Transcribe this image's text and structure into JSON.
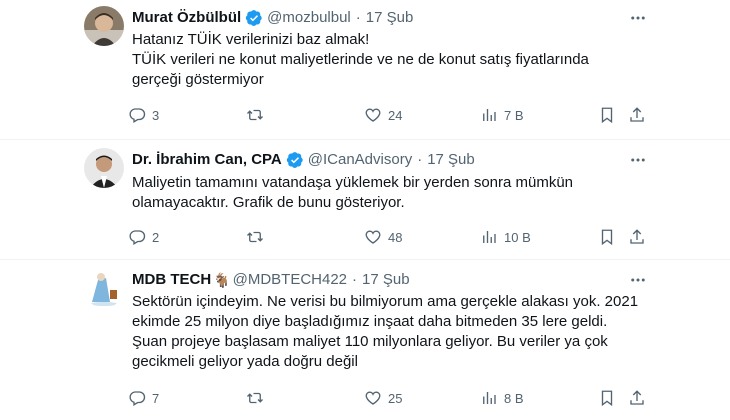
{
  "tweets": [
    {
      "name": "Murat Özbülbül",
      "handle": "@mozbulbul",
      "date": "17 Şub",
      "dot": "·",
      "lines": [
        "Hatanız TÜİK verilerinizi baz almak!",
        "TÜİK verileri ne konut maliyetlerinde ve ne de konut satış fiyatlarında",
        "gerçeği göstermiyor"
      ],
      "replies": "3",
      "retweets": "",
      "likes": "24",
      "views": "7 B"
    },
    {
      "name": "Dr. İbrahim Can, CPA",
      "handle": "@ICanAdvisory",
      "date": "17 Şub",
      "dot": "·",
      "lines": [
        "Maliyetin tamamını vatandaşa yüklemek bir yerden sonra mümkün",
        "olamayacaktır. Grafik de bunu gösteriyor."
      ],
      "replies": "2",
      "retweets": "",
      "likes": "48",
      "views": "10 B"
    },
    {
      "name": "MDB TECH",
      "name_emoji": "🐐",
      "handle": "@MDBTECH422",
      "date": "17 Şub",
      "dot": "·",
      "lines": [
        "Sektörün içindeyim. Ne verisi bu bilmiyorum ama gerçekle alakası yok. 2021",
        "ekimde 25 milyon diye başladığımız inşaat daha bitmeden 35 lere geldi.",
        "Şuan projeye başlasam maliyet 110 milyonlara geliyor. Bu veriler ya çok",
        "gecikmeli geliyor yada doğru değil"
      ],
      "replies": "7",
      "retweets": "",
      "likes": "25",
      "views": "8 B"
    }
  ],
  "colors": {
    "text": "#0f1419",
    "muted": "#536471",
    "verified": "#1d9bf0",
    "divider": "#eff3f4"
  },
  "icons": [
    "verified-badge-icon",
    "more-icon",
    "reply-icon",
    "retweet-icon",
    "like-icon",
    "views-icon",
    "bookmark-icon",
    "share-icon"
  ]
}
